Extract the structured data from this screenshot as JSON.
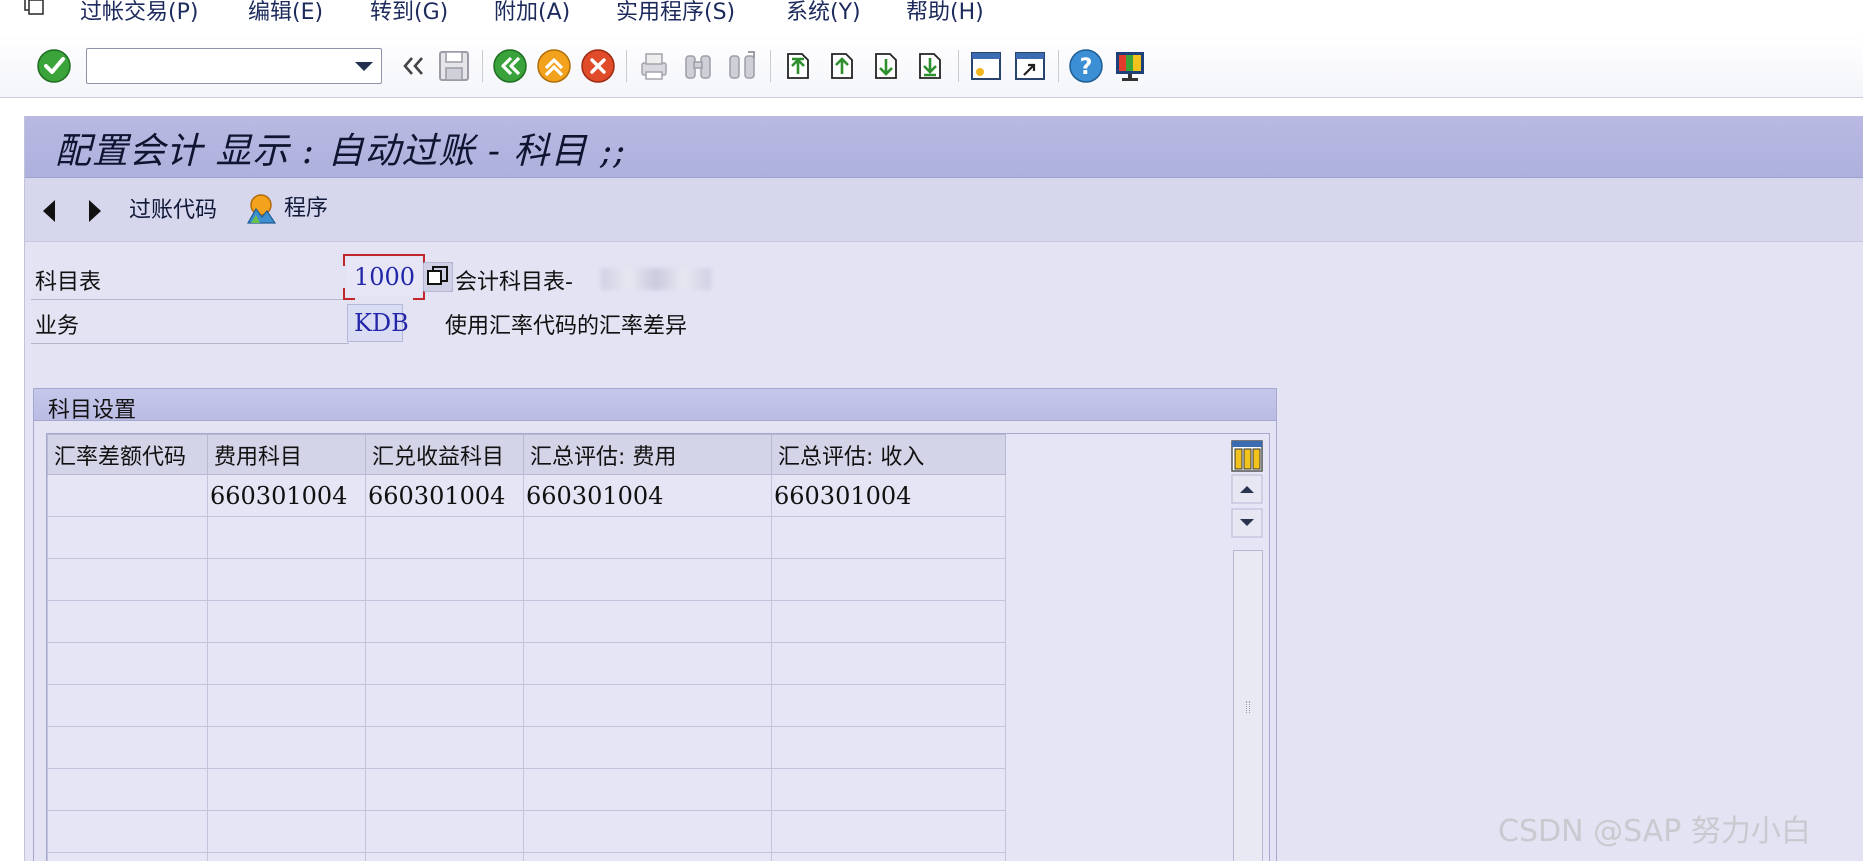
{
  "menu": {
    "items": [
      {
        "label": "过帐交易(P)"
      },
      {
        "label": "编辑(E)"
      },
      {
        "label": "转到(G)"
      },
      {
        "label": "附加(A)"
      },
      {
        "label": "实用程序(S)"
      },
      {
        "label": "系统(Y)"
      },
      {
        "label": "帮助(H)"
      }
    ]
  },
  "toolbar": {
    "command_value": "",
    "icons": [
      "enter-icon",
      "command-dropdown-icon",
      "collapse-icon",
      "save-icon",
      "back-icon",
      "exit-icon",
      "cancel-icon",
      "print-icon",
      "find-icon",
      "find-next-icon",
      "first-page-icon",
      "previous-page-icon",
      "next-page-icon",
      "last-page-icon",
      "create-session-icon",
      "shortcut-icon",
      "help-icon",
      "customize-layout-icon"
    ]
  },
  "page": {
    "title": "配置会计 显示 : 自动过账 - 科目 ;;"
  },
  "appbar": {
    "posting_key_label": "过账代码",
    "procedures_label": "程序"
  },
  "fields": {
    "chart_of_accounts_label": "科目表",
    "chart_of_accounts_value": "1000",
    "chart_of_accounts_desc": "会计科目表-",
    "transaction_label": "业务",
    "transaction_value": "KDB",
    "transaction_desc": "使用汇率代码的汇率差异"
  },
  "group": {
    "title": "科目设置"
  },
  "table": {
    "columns": [
      "汇率差额代码",
      "费用科目",
      "汇兑收益科目",
      "汇总评估: 费用",
      "汇总评估: 收入"
    ],
    "rows": [
      [
        "",
        "660301004",
        "660301004",
        "660301004",
        "660301004"
      ],
      [
        "",
        "",
        "",
        "",
        ""
      ],
      [
        "",
        "",
        "",
        "",
        ""
      ],
      [
        "",
        "",
        "",
        "",
        ""
      ],
      [
        "",
        "",
        "",
        "",
        ""
      ],
      [
        "",
        "",
        "",
        "",
        ""
      ],
      [
        "",
        "",
        "",
        "",
        ""
      ],
      [
        "",
        "",
        "",
        "",
        ""
      ],
      [
        "",
        "",
        "",
        "",
        ""
      ],
      [
        "",
        "",
        "",
        "",
        ""
      ]
    ]
  },
  "watermark": "CSDN @SAP 努力小白",
  "colors": {
    "title_bar": "#b2b3e0",
    "form_bg": "#e3e3f3",
    "field_value": "#2326a8",
    "focus": "#c0262b"
  }
}
